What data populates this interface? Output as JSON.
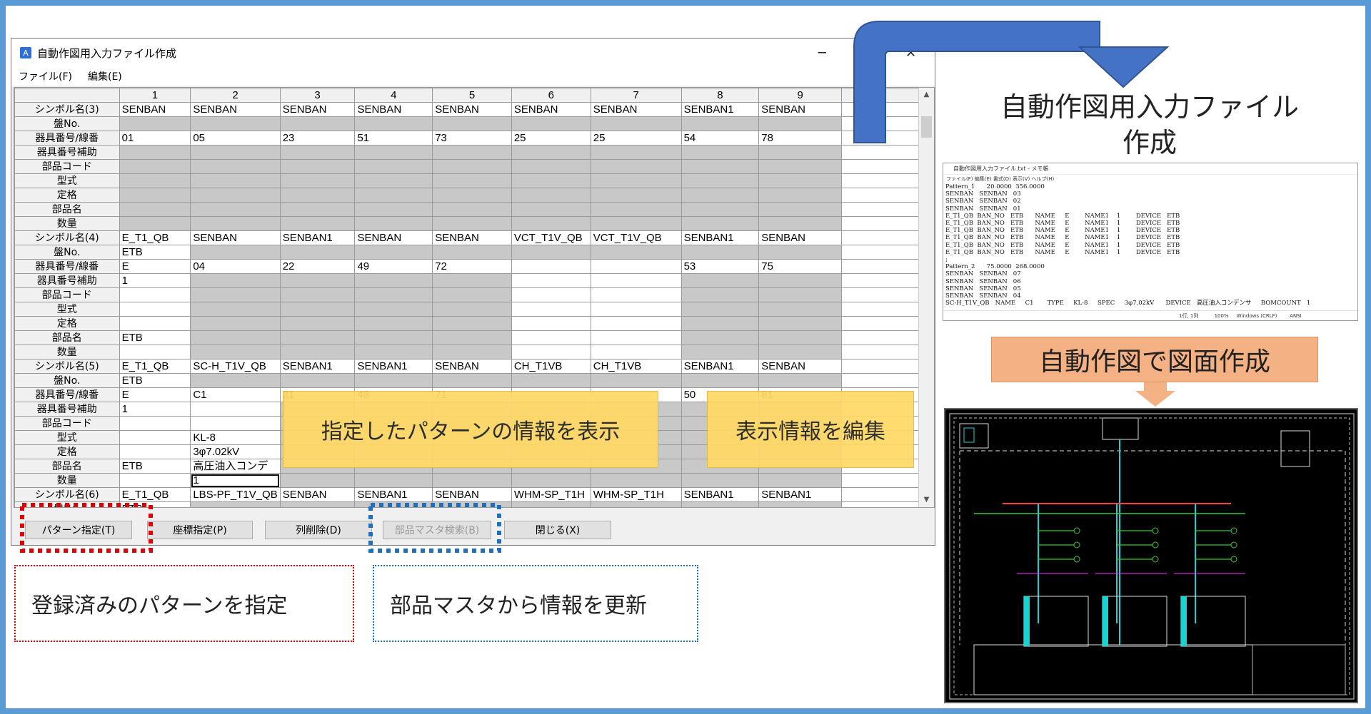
{
  "window": {
    "title": "自動作図用入力ファイル作成",
    "app_icon": "A",
    "minimize": "─",
    "close": "✕",
    "menu": [
      "ファイル(F)",
      "編集(E)"
    ]
  },
  "grid": {
    "columns": [
      "1",
      "2",
      "3",
      "4",
      "5",
      "6",
      "7",
      "8",
      "9"
    ],
    "rows": [
      {
        "h": "シンボル名(3)",
        "c": [
          "SENBAN",
          "SENBAN",
          "SENBAN",
          "SENBAN",
          "SENBAN",
          "SENBAN",
          "SENBAN",
          "SENBAN1",
          "SENBAN"
        ],
        "g": []
      },
      {
        "h": "盤No.",
        "c": [
          "",
          "",
          "",
          "",
          "",
          "",
          "",
          "",
          ""
        ],
        "g": [
          0,
          1,
          2,
          3,
          4,
          5,
          6,
          7,
          8
        ]
      },
      {
        "h": "器具番号/線番",
        "c": [
          "01",
          "05",
          "23",
          "51",
          "73",
          "25",
          "25",
          "54",
          "78"
        ],
        "g": []
      },
      {
        "h": "器具番号補助",
        "c": [
          "",
          "",
          "",
          "",
          "",
          "",
          "",
          "",
          ""
        ],
        "g": [
          0,
          1,
          2,
          3,
          4,
          5,
          6,
          7,
          8
        ]
      },
      {
        "h": "部品コード",
        "c": [
          "",
          "",
          "",
          "",
          "",
          "",
          "",
          "",
          ""
        ],
        "g": [
          0,
          1,
          2,
          3,
          4,
          5,
          6,
          7,
          8
        ]
      },
      {
        "h": "型式",
        "c": [
          "",
          "",
          "",
          "",
          "",
          "",
          "",
          "",
          ""
        ],
        "g": [
          0,
          1,
          2,
          3,
          4,
          5,
          6,
          7,
          8
        ]
      },
      {
        "h": "定格",
        "c": [
          "",
          "",
          "",
          "",
          "",
          "",
          "",
          "",
          ""
        ],
        "g": [
          0,
          1,
          2,
          3,
          4,
          5,
          6,
          7,
          8
        ]
      },
      {
        "h": "部品名",
        "c": [
          "",
          "",
          "",
          "",
          "",
          "",
          "",
          "",
          ""
        ],
        "g": [
          0,
          1,
          2,
          3,
          4,
          5,
          6,
          7,
          8
        ]
      },
      {
        "h": "数量",
        "c": [
          "",
          "",
          "",
          "",
          "",
          "",
          "",
          "",
          ""
        ],
        "g": [
          0,
          1,
          2,
          3,
          4,
          5,
          6,
          7,
          8
        ]
      },
      {
        "h": "シンボル名(4)",
        "c": [
          "E_T1_QB",
          "SENBAN",
          "SENBAN1",
          "SENBAN",
          "SENBAN",
          "VCT_T1V_QB",
          "VCT_T1V_QB",
          "SENBAN1",
          "SENBAN"
        ],
        "g": []
      },
      {
        "h": "盤No.",
        "c": [
          "ETB",
          "",
          "",
          "",
          "",
          "",
          "",
          "",
          ""
        ],
        "g": [
          1,
          2,
          3,
          4,
          5,
          6,
          7,
          8
        ]
      },
      {
        "h": "器具番号/線番",
        "c": [
          "E",
          "04",
          "22",
          "49",
          "72",
          "",
          "",
          "53",
          "75"
        ],
        "g": []
      },
      {
        "h": "器具番号補助",
        "c": [
          "1",
          "",
          "",
          "",
          "",
          "",
          "",
          "",
          ""
        ],
        "g": [
          1,
          2,
          3,
          4,
          7,
          8
        ]
      },
      {
        "h": "部品コード",
        "c": [
          "",
          "",
          "",
          "",
          "",
          "",
          "",
          "",
          ""
        ],
        "g": [
          1,
          2,
          3,
          4,
          7,
          8
        ]
      },
      {
        "h": "型式",
        "c": [
          "",
          "",
          "",
          "",
          "",
          "",
          "",
          "",
          ""
        ],
        "g": [
          1,
          2,
          3,
          4,
          7,
          8
        ]
      },
      {
        "h": "定格",
        "c": [
          "",
          "",
          "",
          "",
          "",
          "",
          "",
          "",
          ""
        ],
        "g": [
          1,
          2,
          3,
          4,
          7,
          8
        ]
      },
      {
        "h": "部品名",
        "c": [
          "ETB",
          "",
          "",
          "",
          "",
          "",
          "",
          "",
          ""
        ],
        "g": [
          1,
          2,
          3,
          4,
          7,
          8
        ]
      },
      {
        "h": "数量",
        "c": [
          "",
          "",
          "",
          "",
          "",
          "",
          "",
          "",
          ""
        ],
        "g": [
          1,
          2,
          3,
          4,
          7,
          8
        ]
      },
      {
        "h": "シンボル名(5)",
        "c": [
          "E_T1_QB",
          "SC-H_T1V_QB",
          "SENBAN1",
          "SENBAN1",
          "SENBAN",
          "CH_T1VB",
          "CH_T1VB",
          "SENBAN1",
          "SENBAN"
        ],
        "g": []
      },
      {
        "h": "盤No.",
        "c": [
          "ETB",
          "",
          "",
          "",
          "",
          "",
          "",
          "",
          ""
        ],
        "g": [
          1,
          2,
          3,
          4,
          5,
          6,
          7,
          8
        ]
      },
      {
        "h": "器具番号/線番",
        "c": [
          "E",
          "C1",
          "21",
          "48",
          "71",
          "",
          "",
          "50",
          "81"
        ],
        "g": []
      },
      {
        "h": "器具番号補助",
        "c": [
          "1",
          "",
          "",
          "",
          "",
          "",
          "",
          "",
          ""
        ],
        "g": [
          2,
          3,
          4,
          5,
          6,
          7,
          8
        ]
      },
      {
        "h": "部品コード",
        "c": [
          "",
          "",
          "",
          "",
          "",
          "",
          "",
          "",
          ""
        ],
        "g": [
          2,
          3,
          4,
          5,
          6,
          7,
          8
        ]
      },
      {
        "h": "型式",
        "c": [
          "",
          "KL-8",
          "",
          "",
          "",
          "",
          "",
          "",
          ""
        ],
        "g": [
          2,
          3,
          4,
          5,
          6,
          7,
          8
        ]
      },
      {
        "h": "定格",
        "c": [
          "",
          "3φ7.02kV",
          "",
          "",
          "",
          "",
          "",
          "",
          ""
        ],
        "g": [
          2,
          3,
          4,
          5,
          6,
          7,
          8
        ]
      },
      {
        "h": "部品名",
        "c": [
          "ETB",
          "高圧油入コンデ",
          "",
          "",
          "",
          "",
          "",
          "",
          ""
        ],
        "g": [
          2,
          3,
          4,
          5,
          6,
          7,
          8
        ]
      },
      {
        "h": "数量",
        "c": [
          "",
          "1",
          "",
          "",
          "",
          "",
          "",
          "",
          ""
        ],
        "g": [
          2,
          3,
          4,
          5,
          6,
          7,
          8
        ]
      },
      {
        "h": "シンボル名(6)",
        "c": [
          "E_T1_QB",
          "LBS-PF_T1V_QB",
          "SENBAN",
          "SENBAN1",
          "SENBAN",
          "WHM-SP_T1H",
          "WHM-SP_T1H",
          "SENBAN1",
          "SENBAN1"
        ],
        "g": []
      },
      {
        "h": "盤No.",
        "c": [
          "ETB",
          "",
          "",
          "",
          "",
          "",
          "",
          "",
          ""
        ],
        "g": [
          1,
          2,
          3,
          4,
          5,
          6,
          7,
          8
        ]
      }
    ]
  },
  "buttons": [
    {
      "label": "パターン指定(T)",
      "disabled": false
    },
    {
      "label": "座標指定(P)",
      "disabled": false
    },
    {
      "label": "列削除(D)",
      "disabled": false
    },
    {
      "label": "部品マスタ検索(B)",
      "disabled": true
    },
    {
      "label": "閉じる(X)",
      "disabled": false
    }
  ],
  "callouts": {
    "show_pattern": "指定したパターンの情報を表示",
    "edit_info": "表示情報を編集",
    "specify_pattern": "登録済みのパターンを指定",
    "update_master": "部品マスタから情報を更新",
    "create_file": "自動作図用入力ファイル\n作成",
    "auto_draw": "自動作図で図面作成"
  },
  "notepad": {
    "title": "自動作図用入力ファイル.txt - メモ帳",
    "menu": "ファイル(F)  編集(E)  書式(O)  表示(V)  ヘルプ(H)",
    "body": "Pattern_1      20.0000  356.0000\nSENBAN   SENBAN   03\nSENBAN   SENBAN   02\nSENBAN   SENBAN   01\nE_T1_QB  BAN_NO   ETB      NAME     E        NAME1    1        DEVICE   ETB\nE_T1_QB  BAN_NO   ETB      NAME     E        NAME1    1        DEVICE   ETB\nE_T1_QB  BAN_NO   ETB      NAME     E        NAME1    1        DEVICE   ETB\nE_T1_QB  BAN_NO   ETB      NAME     E        NAME1    1        DEVICE   ETB\nE_T1_QB  BAN_NO   ETB      NAME     E        NAME1    1        DEVICE   ETB\nE_T1_QB  BAN_NO   ETB      NAME     E        NAME1    1        DEVICE   ETB\n;\nPattern_2      75.0000  268.0000\nSENBAN   SENBAN   07\nSENBAN   SENBAN   06\nSENBAN   SENBAN   05\nSENBAN   SENBAN   04\nSC-H_T1V_QB   NAME     C1       TYPE     KL-8     SPEC     3φ7.02kV      DEVICE   高圧油入コンデンサ     BOMCOUNT   1",
    "status": "1行, 1列          100%     Windows (CRLF)        ANSI"
  },
  "colors": {
    "frame": "#5b9bd5",
    "arrow": "#4472c4",
    "callout_yellow": "#ffd966",
    "orange": "#f4b183",
    "red_dash": "#e00000",
    "blue_dash": "#1f6fbf"
  }
}
